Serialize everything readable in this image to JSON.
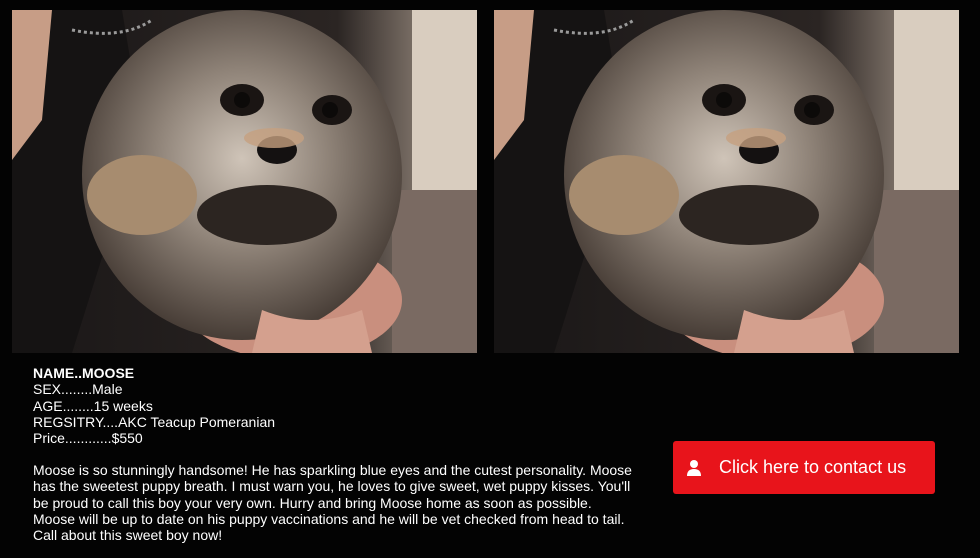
{
  "photos": [
    {
      "alt_name": "puppy-photo"
    },
    {
      "alt_name": "puppy-photo"
    }
  ],
  "details": {
    "name": "NAME..MOOSE",
    "sex": "SEX........Male",
    "age": "AGE........15 weeks",
    "registry": "REGSITRY....AKC Teacup Pomeranian",
    "price": "Price............$550"
  },
  "description": "Moose is so stunningly handsome! He has sparkling blue eyes and the cutest personality. Moose has the sweetest puppy breath. I must warn you, he loves to give sweet, wet puppy kisses. You'll be proud to call this boy your very own. Hurry and bring Moose home as soon as possible. Moose will be up to date on his puppy vaccinations and he will be vet checked from head to tail. Call about this sweet boy now!",
  "contact_button": {
    "label": "Click here to contact us",
    "icon": "user-icon",
    "color": "#e8141b"
  }
}
